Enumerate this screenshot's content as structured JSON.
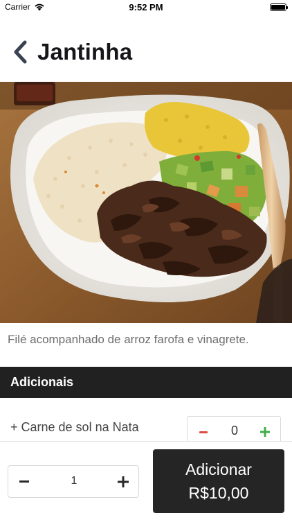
{
  "status_bar": {
    "carrier": "Carrier",
    "time": "9:52 PM",
    "icons": [
      "wifi-icon",
      "battery-icon"
    ]
  },
  "header": {
    "back_icon": "chevron-left-icon",
    "title": "Jantinha"
  },
  "dish": {
    "photo": "plate-of-rice-farofa-beef-and-vinaigrette",
    "description": "Filé acompanhado de arroz farofa e vinagrete."
  },
  "addons_section": {
    "title": "Adicionais",
    "items": [
      {
        "label": "+ Carne de sol na Nata",
        "quantity": "0"
      }
    ]
  },
  "footer": {
    "quantity": "1",
    "add_label": "Adicionar",
    "price": "R$10,00"
  },
  "colors": {
    "dark": "#212121",
    "minus_red": "#e0493f",
    "plus_green": "#3fae49",
    "description_gray": "#6d6d6d"
  }
}
